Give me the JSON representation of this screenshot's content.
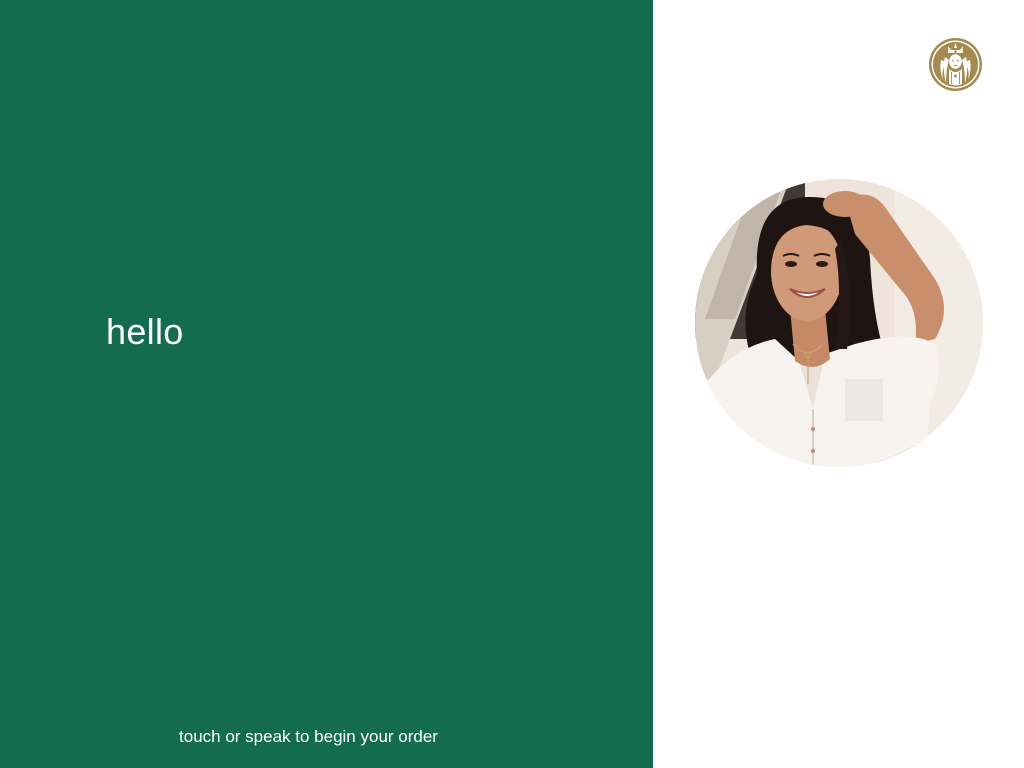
{
  "welcome": {
    "greeting": "hello",
    "prompt": "touch or speak to begin your order"
  },
  "brand": {
    "logo_icon": "siren-logo-icon",
    "primary_color": "#146c4f",
    "logo_color": "#a48a4f",
    "background_color": "#ffffff"
  },
  "avatar": {
    "icon": "assistant-portrait"
  }
}
